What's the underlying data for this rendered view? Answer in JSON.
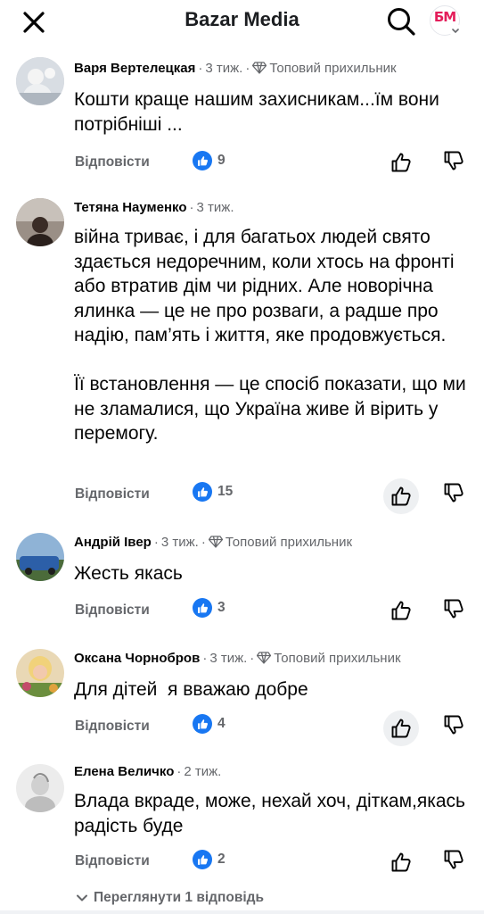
{
  "header": {
    "title": "Bazar Media",
    "page_avatar_text": "БМ",
    "close_icon": "close-icon",
    "search_icon": "search-icon"
  },
  "labels": {
    "reply": "Відповісти",
    "top_fan": "Топовий прихильник",
    "separator": "·"
  },
  "comments": [
    {
      "author": "Варя Вертелецкая",
      "time": "3 тиж.",
      "top_fan": true,
      "text": [
        "Кошти краще нашим захисникам...їм вони потрібніші ..."
      ],
      "likes": "9",
      "like_pressed": false
    },
    {
      "author": "Тетяна Науменко",
      "time": "3 тиж.",
      "top_fan": false,
      "text": [
        "війна триває, і для багатьох людей свято здається недоречним, коли хтось на фронті або втратив дім чи рідних. Але новорічна ялинка — це не про розваги, а радше про надію, пам’ять і життя, яке продовжується.",
        "Її встановлення — це спосіб показати, що ми не зламалися, що Україна живе й вірить у перемогу."
      ],
      "likes": "15",
      "like_pressed": true
    },
    {
      "author": "Андрій Івер",
      "time": "3 тиж.",
      "top_fan": true,
      "text": [
        "Жесть якась"
      ],
      "likes": "3",
      "like_pressed": false
    },
    {
      "author": "Оксана Чорнобров",
      "time": "3 тиж.",
      "top_fan": true,
      "text": [
        "Для дітей  я вважаю добре"
      ],
      "likes": "4",
      "like_pressed": true
    },
    {
      "author": "Елена Величко",
      "time": "2 тиж.",
      "top_fan": false,
      "text": [
        "Влада вкраде, може, нехай хоч, діткам,якась радість буде"
      ],
      "likes": "2",
      "like_pressed": false
    }
  ],
  "view_replies": "Переглянути 1 відповідь",
  "colors": {
    "like_blue": "#1877f2",
    "secondary_text": "#65676b",
    "brand_pink": "#e41e5b"
  }
}
